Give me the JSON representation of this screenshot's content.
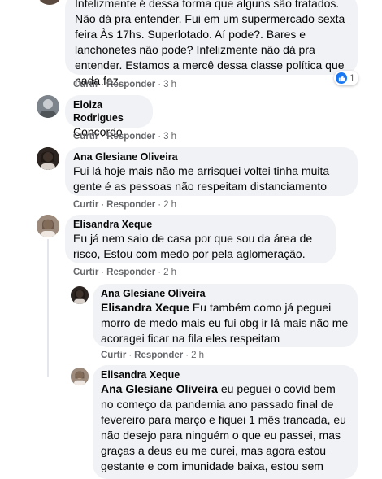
{
  "comments": [
    {
      "text": "Infelizmente é dessa forma que alguns são tratados. Não dá pra entender. Fui em um supermercado sexta feira Às 17hs. Superlotado. Aí pode?. Bares e lanchonetes não pode? Infelizmente não dá pra entender. Estamos a mercê dessa classe política que nada faz.",
      "like_label": "Curtir",
      "reply_label": "Responder",
      "time": "3 h",
      "reaction_count": "1"
    },
    {
      "author": "Eloiza Rodrigues",
      "text": "Concordo",
      "like_label": "Curtir",
      "reply_label": "Responder",
      "time": "3 h"
    },
    {
      "author": "Ana Glesiane Oliveira",
      "text": "Fui lá hoje mais não me arrisquei voltei tinha muita gente é as pessoas não respeitam distanciamento",
      "like_label": "Curtir",
      "reply_label": "Responder",
      "time": "2 h"
    },
    {
      "author": "Elisandra Xeque",
      "text": "Eu já nem saio de casa por que sou da área de risco, Estou com medo por pela aglomeração.",
      "like_label": "Curtir",
      "reply_label": "Responder",
      "time": "2 h"
    }
  ],
  "replies": [
    {
      "author": "Ana Glesiane Oliveira",
      "mention": "Elisandra Xeque",
      "text": " Eu também como já peguei morro de medo mais eu fui obg ir lá mais não me acoragei ficar na fila eles respeitam",
      "like_label": "Curtir",
      "reply_label": "Responder",
      "time": "2 h"
    },
    {
      "author": "Elisandra Xeque",
      "mention": "Ana Glesiane Oliveira",
      "text": " eu peguei o covid bem no começo da pandemia ano passado final de fevereiro para março e fiquei 1 mês trancada, eu não desejo para ninguém o que eu passei, mas graças a deus eu me curei, mas agora estou gestante e com imunidade baixa, estou sem"
    }
  ],
  "meta_separator": "·",
  "colors": {
    "bubble": "#f0f2f5",
    "meta": "#65676b",
    "like_blue": "#1877f2"
  }
}
